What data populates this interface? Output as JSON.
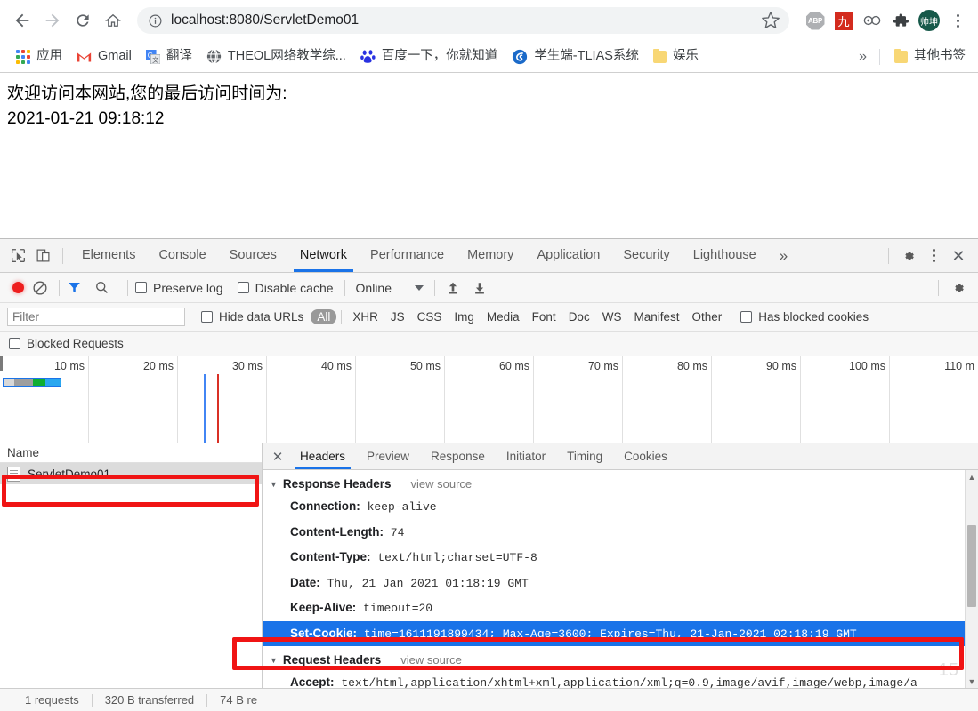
{
  "browser": {
    "nav": {
      "back": "back-arrow",
      "forward": "forward-arrow",
      "reload": "reload",
      "home": "home"
    },
    "omnibox": {
      "info_icon": "info-circle-icon",
      "url": "localhost:8080/ServletDemo01",
      "star_icon": "bookmark-star-icon"
    },
    "extensions": [
      {
        "name": "adblock-plus",
        "label": "ABP"
      },
      {
        "name": "jiu-extension",
        "label": "九"
      },
      {
        "name": "link-extension",
        "label": ""
      },
      {
        "name": "puzzle-extensions",
        "label": ""
      }
    ],
    "profile_label": "帅坤",
    "menu_icon": "kebab-menu-icon",
    "bookmarks": [
      {
        "label": "应用",
        "icon": "apps-grid-icon"
      },
      {
        "label": "Gmail",
        "icon": "gmail-icon"
      },
      {
        "label": "翻译",
        "icon": "google-translate-icon"
      },
      {
        "label": "THEOL网络教学综...",
        "icon": "globe-icon"
      },
      {
        "label": "百度一下，你就知道",
        "icon": "baidu-icon"
      },
      {
        "label": "学生端-TLIAS系统",
        "icon": "swirl-icon"
      },
      {
        "label": "娱乐",
        "icon": "folder-icon"
      }
    ],
    "bookmarks_overflow": "»",
    "other_bookmarks": {
      "label": "其他书签",
      "icon": "folder-icon"
    }
  },
  "page": {
    "line1": "欢迎访问本网站,您的最后访问时间为:",
    "line2": "2021-01-21 09:18:12"
  },
  "devtools": {
    "inspect_icon": "inspect-element-icon",
    "device_icon": "device-toolbar-icon",
    "tabs": [
      "Elements",
      "Console",
      "Sources",
      "Network",
      "Performance",
      "Memory",
      "Application",
      "Security",
      "Lighthouse"
    ],
    "active_tab": "Network",
    "tabs_overflow": "»",
    "settings_icon": "gear-icon",
    "more_icon": "kebab-menu-icon",
    "close_icon": "close-icon",
    "network_toolbar": {
      "record_icon": "record-button",
      "clear_icon": "clear-icon",
      "filter_icon": "filter-funnel-icon",
      "search_icon": "search-icon",
      "preserve_log": "Preserve log",
      "disable_cache": "Disable cache",
      "throttling": "Online",
      "import_icon": "import-har-icon",
      "export_icon": "export-har-icon",
      "network_settings_icon": "gear-icon"
    },
    "filter_bar": {
      "placeholder": "Filter",
      "value": "",
      "hide_data_urls": "Hide data URLs",
      "types": [
        "All",
        "XHR",
        "JS",
        "CSS",
        "Img",
        "Media",
        "Font",
        "Doc",
        "WS",
        "Manifest",
        "Other"
      ],
      "active_type": "All",
      "has_blocked_cookies": "Has blocked cookies"
    },
    "blocked_requests": "Blocked Requests",
    "overview": {
      "ticks": [
        "10 ms",
        "20 ms",
        "30 ms",
        "40 ms",
        "50 ms",
        "60 ms",
        "70 ms",
        "80 ms",
        "90 ms",
        "100 ms",
        "110 m"
      ],
      "waterfall_colors": {
        "stalled": "#d8d8d8",
        "request_sent": "#9e9e9e",
        "waiting": "#0fae32",
        "download": "#2aa7ef",
        "border": "#1a73e8"
      },
      "dom_content_loaded_color": "#4285f4",
      "load_event_color": "#d93025"
    },
    "requests": {
      "column_header": "Name",
      "rows": [
        {
          "name": "ServletDemo01",
          "icon": "document-icon",
          "selected": true
        }
      ]
    },
    "details": {
      "close_icon": "close-icon",
      "tabs": [
        "Headers",
        "Preview",
        "Response",
        "Initiator",
        "Timing",
        "Cookies"
      ],
      "active_tab": "Headers",
      "response_headers": {
        "title": "Response Headers",
        "view_source": "view source",
        "rows": [
          {
            "name": "Connection:",
            "value": "keep-alive",
            "selected": false
          },
          {
            "name": "Content-Length:",
            "value": "74",
            "selected": false
          },
          {
            "name": "Content-Type:",
            "value": "text/html;charset=UTF-8",
            "selected": false
          },
          {
            "name": "Date:",
            "value": "Thu, 21 Jan 2021 01:18:19 GMT",
            "selected": false
          },
          {
            "name": "Keep-Alive:",
            "value": "timeout=20",
            "selected": false
          },
          {
            "name": "Set-Cookie:",
            "value": "time=1611191899434; Max-Age=3600; Expires=Thu, 21-Jan-2021 02:18:19 GMT",
            "selected": true
          }
        ]
      },
      "request_headers": {
        "title": "Request Headers",
        "view_source": "view source",
        "rows": [
          {
            "name": "Accept:",
            "value": "text/html,application/xhtml+xml,application/xml;q=0.9,image/avif,image/webp,image/a",
            "selected": false
          }
        ]
      }
    },
    "status_bar": {
      "requests": "1 requests",
      "transferred": "320 B transferred",
      "resources": "74 B re"
    }
  },
  "annotations": {
    "color": "#f01414",
    "boxes": [
      "request-row-highlight",
      "set-cookie-header-highlight"
    ]
  },
  "watermark": "15"
}
